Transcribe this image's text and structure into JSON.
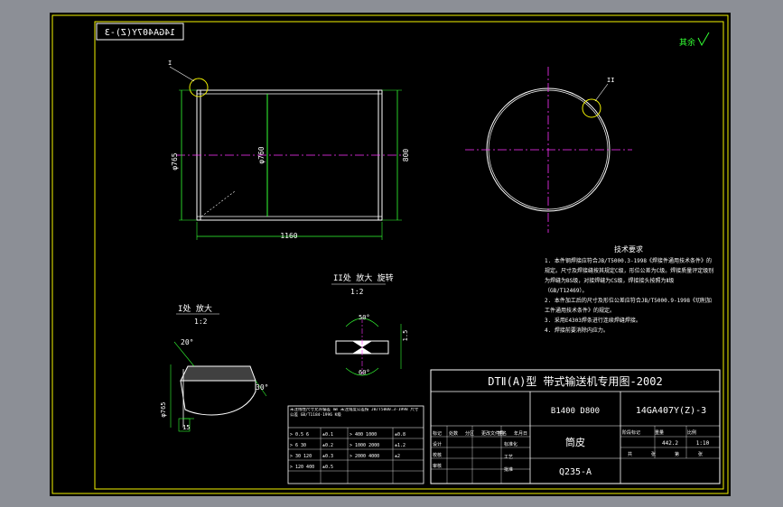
{
  "stamp_code": "14GA407Y(Z)-3",
  "roughness_mark": "其余",
  "title_block": {
    "title": "DTⅡ(A)型  带式输送机专用图-2002",
    "spec": "B1400  D800",
    "drawing_no": "14GA407Y(Z)-3",
    "part_name": "筒皮",
    "material": "Q235-A",
    "weight": "442.2",
    "scale": "1:10",
    "row_labels": [
      "设计",
      "校核",
      "审核"
    ],
    "header_labels": [
      "标记",
      "处数",
      "分区",
      "更改文件号",
      "签名",
      "年月日"
    ],
    "col_labels": [
      "标准化",
      "工艺",
      "批准"
    ],
    "mass_labels": [
      "阶段标记",
      "重量",
      "比例"
    ],
    "sheet_labels": [
      "共",
      "张",
      "第",
      "张"
    ]
  },
  "tech_requirements": {
    "heading": "技术要求",
    "items": [
      "1. 本件钢焊接应符合JB/T5000.3-1998《焊接件通用技术条件》的规定。尺寸及焊接缝按其规定C级，形位公差为C级。焊接质量评定级别为焊缝为BS级，对接焊缝为CS级，焊接接头按照为Ⅱ级（GB/T12469）。",
      "2. 本件加工后的尺寸及形位公差应符合JB/T5000.9-1998《切削加工件通用技术条件》的规定。",
      "3. 采用E4303焊条进行连续焊缝焊接。",
      "4. 焊接前要消除内应力。"
    ]
  },
  "dimensions": {
    "outer_dia": "φ765",
    "inner_dia": "φ760",
    "length": "1160",
    "dim_right": "800",
    "detail_angle_top": "20°",
    "detail_angle_side": "30°",
    "detail_width": "15",
    "detail_dia": "φ765",
    "weld_angle_top": "50°",
    "weld_angle_bottom": "60°",
    "weld_dim": "1.5"
  },
  "callouts": {
    "detail_I_label": "I处 放大",
    "detail_I_scale": "1:2",
    "detail_II_label": "II处 放大 旋转",
    "detail_II_scale": "1:2",
    "marker_I": "I",
    "marker_II": "II"
  },
  "tolerance_table": {
    "note": "未注线性尺寸允许偏差 mm  未注角度公差按 JB/T5000.3-1998  尺寸公差 GB/T1184-1996 K级",
    "rows": [
      [
        "> 0.5   6",
        "±0.1",
        "> 400  1000",
        "±0.8"
      ],
      [
        "> 6   30",
        "±0.2",
        "> 1000  2000",
        "±1.2"
      ],
      [
        "> 30  120",
        "±0.3",
        "> 2000  4000",
        "±2"
      ],
      [
        "> 120  400",
        "±0.5",
        "",
        ""
      ]
    ]
  }
}
